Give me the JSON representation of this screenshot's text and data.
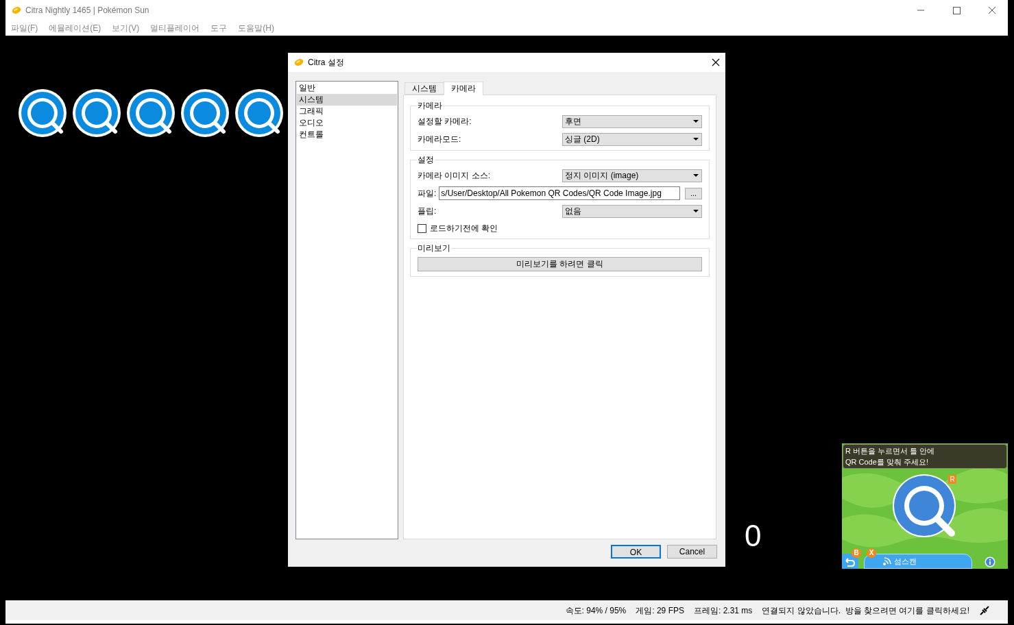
{
  "window": {
    "title": "Citra Nightly 1465 | Pokémon Sun",
    "menu": [
      "파일(F)",
      "에뮬레이션(E)",
      "보기(V)",
      "멀티플레이어",
      "도구",
      "도움말(H)"
    ]
  },
  "game": {
    "counter": "0",
    "bottom_screen": {
      "prompt": [
        "R 버튼을 누르면서 틀 안에",
        "QR Code를 맞춰 주세요!"
      ],
      "r_badge": "R",
      "back_badge": "B",
      "scan_badge": "X",
      "scan_button": "섬스캔"
    }
  },
  "dialog": {
    "title": "Citra 설정",
    "sidebar": [
      {
        "label": "일반",
        "selected": false
      },
      {
        "label": "시스템",
        "selected": true
      },
      {
        "label": "그래픽",
        "selected": false
      },
      {
        "label": "오디오",
        "selected": false
      },
      {
        "label": "컨트롤",
        "selected": false
      }
    ],
    "tabs": [
      {
        "label": "시스템",
        "selected": false
      },
      {
        "label": "카메라",
        "selected": true
      }
    ],
    "groups": [
      {
        "title": "카메라",
        "rows": [
          {
            "kind": "select",
            "label": "설정할 카메라:",
            "value": "후면"
          },
          {
            "kind": "select",
            "label": "카메라모드:",
            "value": "싱글 (2D)"
          }
        ]
      },
      {
        "title": "설정",
        "rows": [
          {
            "kind": "select",
            "label": "카메라 이미지 소스:",
            "value": "정지 이미지 (image)"
          },
          {
            "kind": "file",
            "label": "파일:",
            "value": "s/User/Desktop/All Pokemon QR Codes/QR Code Image.jpg",
            "browse": "..."
          },
          {
            "kind": "select",
            "label": "플립:",
            "value": "없음"
          },
          {
            "kind": "checkbox",
            "label": "로드하기전에 확인",
            "checked": false
          }
        ]
      },
      {
        "title": "미리보기",
        "rows": [
          {
            "kind": "button",
            "label": "미리보기를 하려면 클릭"
          }
        ]
      }
    ],
    "buttons": [
      {
        "label": "OK",
        "default": true
      },
      {
        "label": "Cancel",
        "default": false
      }
    ]
  },
  "status_bar": [
    "속도: 94% / 95%",
    "게임: 29 FPS",
    "프레임: 2.31 ms",
    "연결되지 않았습니다.  방을 찾으려면 여기를 클릭하세요!"
  ]
}
